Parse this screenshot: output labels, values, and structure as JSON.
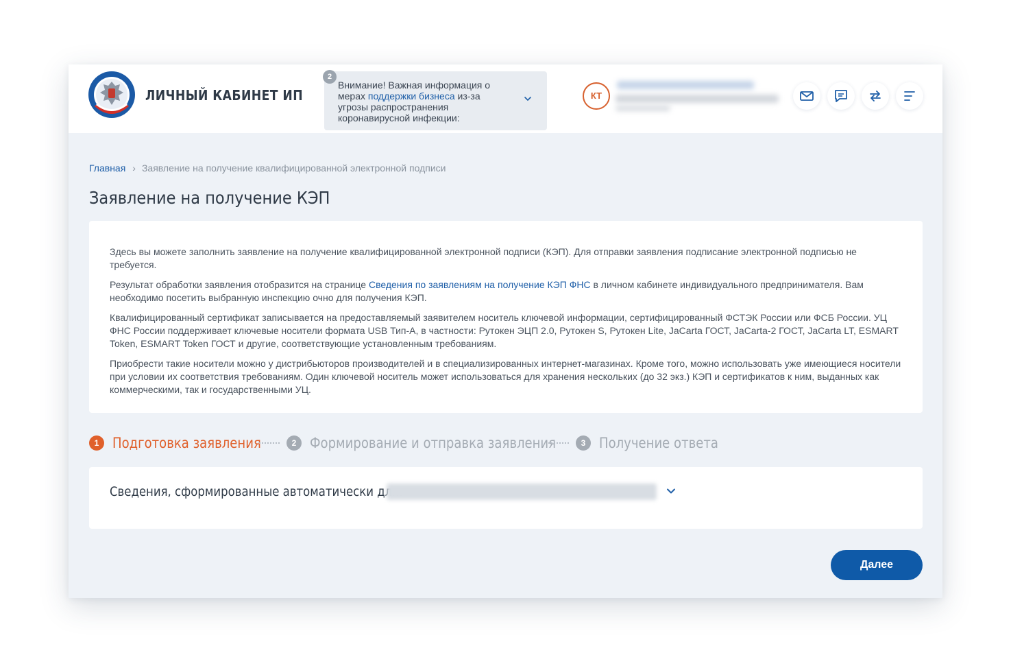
{
  "header": {
    "cabinet_title": "ЛИЧНЫЙ КАБИНЕТ ИП",
    "notice": {
      "badge_count": "2",
      "text_before_link": "Внимание! Важная информация о мерах ",
      "link_text": "поддержки бизнеса",
      "text_after_link": " из-за угрозы распространения коронавирусной инфекции:"
    },
    "user": {
      "avatar_initials": "КТ"
    },
    "icons": [
      "mail-icon",
      "chat-icon",
      "switch-icon",
      "menu-icon"
    ]
  },
  "breadcrumb": {
    "home": "Главная",
    "separator": "›",
    "current": "Заявление на получение квалифицированной электронной подписи"
  },
  "page_title": "Заявление на получение КЭП",
  "info": {
    "p1": "Здесь вы можете заполнить заявление на получение квалифицированной электронной подписи (КЭП). Для отправки заявления подписание электронной подписью не требуется.",
    "p2_before_link": "Результат обработки заявления отобразится на странице ",
    "p2_link": "Сведения по заявлениям на получение КЭП ФНС",
    "p2_after_link": " в личном кабинете индивидуального предпринимателя. Вам необходимо посетить выбранную инспекцию очно для получения КЭП.",
    "p3": "Квалифицированный сертификат записывается на предоставляемый заявителем носитель ключевой информации, сертифицированный ФСТЭК России или ФСБ России. УЦ ФНС России поддерживает ключевые носители формата USB Тип-А, в частности: Рутокен ЭЦП 2.0, Рутокен S, Рутокен Lite, JaCarta ГОСТ, JaCarta-2 ГОСТ, JaCarta LT, ESMART Token, ESMART Token ГОСТ и другие, соответствующие установленным требованиям.",
    "p4": "Приобрести такие носители можно у дистрибьюторов производителей и в специализированных интернет-магазинах. Кроме того, можно использовать уже имеющиеся носители при условии их соответствия требованиям. Один ключевой носитель может использоваться для хранения нескольких (до 32 экз.) КЭП и сертификатов к ним, выданных как коммерческими, так и государственными УЦ."
  },
  "steps": [
    {
      "num": "1",
      "label": "Подготовка заявления",
      "state": "active"
    },
    {
      "num": "2",
      "label": "Формирование и отправка заявления",
      "state": "inactive"
    },
    {
      "num": "3",
      "label": "Получение ответа",
      "state": "inactive"
    }
  ],
  "auto_section": {
    "label": "Сведения, сформированные автоматически для:"
  },
  "actions": {
    "next_label": "Далее"
  },
  "colors": {
    "accent_orange": "#e0602b",
    "primary_blue": "#0f5aa8",
    "link_blue": "#1f5fa8",
    "page_bg": "#eef2f7"
  }
}
